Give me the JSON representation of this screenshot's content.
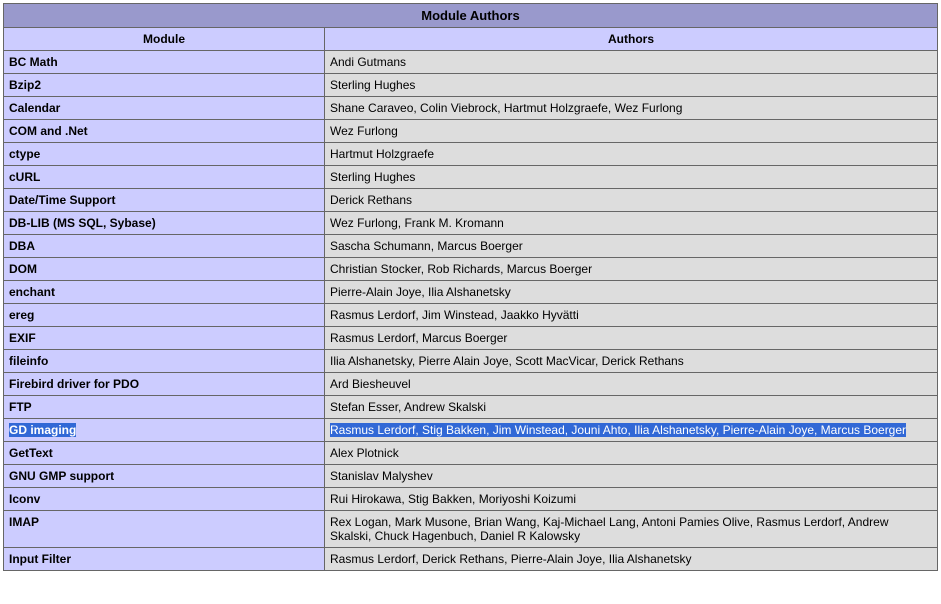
{
  "table": {
    "title": "Module Authors",
    "headers": {
      "module": "Module",
      "authors": "Authors"
    },
    "rows": [
      {
        "module": "BC Math",
        "authors": "Andi Gutmans"
      },
      {
        "module": "Bzip2",
        "authors": "Sterling Hughes"
      },
      {
        "module": "Calendar",
        "authors": "Shane Caraveo, Colin Viebrock, Hartmut Holzgraefe, Wez Furlong"
      },
      {
        "module": "COM and .Net",
        "authors": "Wez Furlong"
      },
      {
        "module": "ctype",
        "authors": "Hartmut Holzgraefe"
      },
      {
        "module": "cURL",
        "authors": "Sterling Hughes"
      },
      {
        "module": "Date/Time Support",
        "authors": "Derick Rethans"
      },
      {
        "module": "DB-LIB (MS SQL, Sybase)",
        "authors": "Wez Furlong, Frank M. Kromann"
      },
      {
        "module": "DBA",
        "authors": "Sascha Schumann, Marcus Boerger"
      },
      {
        "module": "DOM",
        "authors": "Christian Stocker, Rob Richards, Marcus Boerger"
      },
      {
        "module": "enchant",
        "authors": "Pierre-Alain Joye, Ilia Alshanetsky"
      },
      {
        "module": "ereg",
        "authors": "Rasmus Lerdorf, Jim Winstead, Jaakko Hyvätti"
      },
      {
        "module": "EXIF",
        "authors": "Rasmus Lerdorf, Marcus Boerger"
      },
      {
        "module": "fileinfo",
        "authors": "Ilia Alshanetsky, Pierre Alain Joye, Scott MacVicar, Derick Rethans"
      },
      {
        "module": "Firebird driver for PDO",
        "authors": "Ard Biesheuvel"
      },
      {
        "module": "FTP",
        "authors": "Stefan Esser, Andrew Skalski"
      },
      {
        "module": "GD imaging",
        "authors": "Rasmus Lerdorf, Stig Bakken, Jim Winstead, Jouni Ahto, Ilia Alshanetsky, Pierre-Alain Joye, Marcus Boerger",
        "highlighted": true
      },
      {
        "module": "GetText",
        "authors": "Alex Plotnick"
      },
      {
        "module": "GNU GMP support",
        "authors": "Stanislav Malyshev"
      },
      {
        "module": "Iconv",
        "authors": "Rui Hirokawa, Stig Bakken, Moriyoshi Koizumi"
      },
      {
        "module": "IMAP",
        "authors": "Rex Logan, Mark Musone, Brian Wang, Kaj-Michael Lang, Antoni Pamies Olive, Rasmus Lerdorf, Andrew Skalski, Chuck Hagenbuch, Daniel R Kalowsky"
      },
      {
        "module": "Input Filter",
        "authors": "Rasmus Lerdorf, Derick Rethans, Pierre-Alain Joye, Ilia Alshanetsky"
      }
    ]
  }
}
